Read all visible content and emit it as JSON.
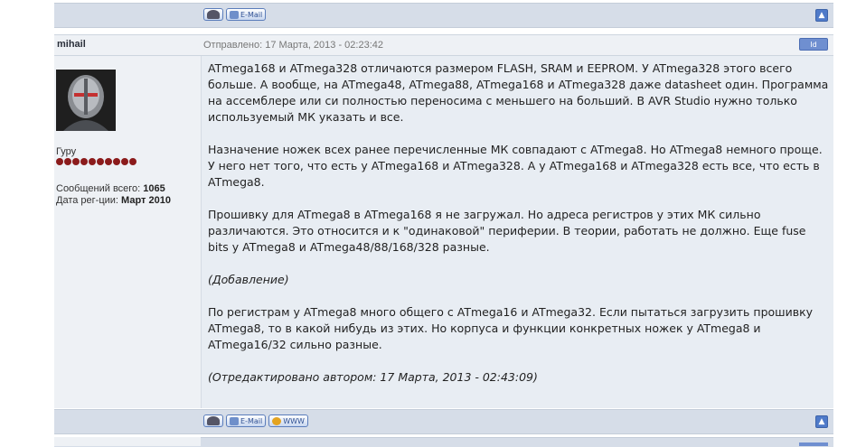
{
  "post": {
    "username": "mihail",
    "sent_label": "Отправлено: 17 Марта, 2013 - 02:23:42",
    "id_button": "Id",
    "rank": "Гуру",
    "messages_label": "Сообщений всего:",
    "messages_count": "1065",
    "reg_label": "Дата рег-ции:",
    "reg_date": "Март 2010",
    "paragraphs": [
      "ATmega168 и ATmega328 отличаются размером FLASH, SRAM и EEPROM. У ATmega328 этого всего больше. А вообще, на ATmega48, ATmega88, ATmega168 и ATmega328 даже datasheet один. Программа на ассемблере или си полностью переносима с меньшего на больший. В AVR Studio нужно только используемый МК указать и все.",
      "Назначение ножек всех ранее перечисленные МК совпадают с ATmega8. Но ATmega8 немного проще. У него нет того, что есть у ATmega168 и ATmega328. А у ATmega168 и ATmega328 есть все, что есть в ATmega8.",
      "Прошивку для ATmega8 в ATmega168 я не загружал. Но адреса регистров у этих МК сильно различаются. Это относится и к \"одинаковой\" периферии. В теории, работать не должно. Еще fuse bits у ATmega8 и ATmega48/88/168/328 разные.",
      "(Добавление)",
      "По регистрам у ATmega8 много общего с ATmega16 и ATmega32. Если пытаться загрузить прошивку ATmega8, то в какой нибудь из этих. Но корпуса и функции конкретных ножек у ATmega8 и ATmega16/32 сильно разные.",
      "(Отредактировано автором: 17 Марта, 2013 - 02:43:09)"
    ]
  },
  "buttons": {
    "email": "E-Mail",
    "www": "WWW",
    "up_icon": "arrow-up-icon"
  },
  "colors": {
    "bar": "#d6dde8",
    "post_bg": "#e8edf3",
    "side_bg": "#eef1f5",
    "accent": "#4f7ac9",
    "stars": "#8b1b1b"
  }
}
